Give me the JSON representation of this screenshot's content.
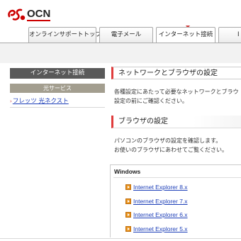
{
  "header": {
    "logo_text": "OCN"
  },
  "tabs": [
    {
      "label": "オンラインサポートトップ"
    },
    {
      "label": "電子メール"
    },
    {
      "label": "インターネット接続"
    },
    {
      "label": "I"
    }
  ],
  "sidebar": {
    "heading": "インターネット接続",
    "subheading": "光サービス",
    "link": "フレッツ 光ネクスト"
  },
  "main": {
    "section1_title": "ネットワークとブラウザの設定",
    "section1_line1": "各種設定にあたって必要なネットワークとブラウ",
    "section1_line2": "設定の前にご確認ください。",
    "section2_title": "ブラウザの設定",
    "section2_line1": "パソコンのブラウザの設定を確認します。",
    "section2_line2": "お使いのブラウザにあわせてご覧ください。",
    "windows_label": "Windows",
    "ie_links": [
      "Internet Explorer 8.x",
      "Internet Explorer 7.x",
      "Internet Explorer 6.x",
      "Internet Explorer 5.x"
    ]
  },
  "colors": {
    "accent_red": "#e03c3c",
    "link_blue": "#1d3fb8",
    "sidebar_dark": "#595959",
    "sidebar_tan": "#a39e8f",
    "arrow_orange": "#e8921c"
  }
}
